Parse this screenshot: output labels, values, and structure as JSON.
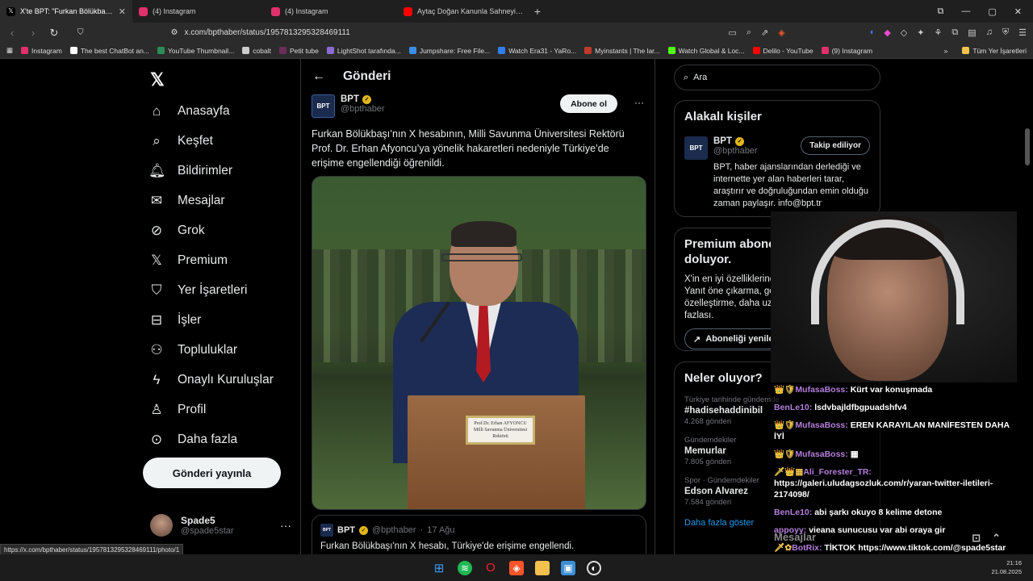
{
  "browser": {
    "tabs": [
      {
        "label": "X'te BPT: \"Furkan Bölükbaşı'nın X",
        "color": "#000000",
        "icon": "x-logo-icon"
      },
      {
        "label": "(4) Instagram",
        "color": "#e1306c",
        "icon": "instagram-icon"
      },
      {
        "label": "(4) Instagram",
        "color": "#e1306c",
        "icon": "instagram-icon"
      },
      {
        "label": "Aytaç Doğan Kanunla Sahneyi Yıktı |",
        "color": "#ff0000",
        "icon": "youtube-icon"
      }
    ],
    "url": "x.com/bpthaber/status/1957813295328469111",
    "bookmarks": [
      {
        "label": "Instagram",
        "color": "#e1306c"
      },
      {
        "label": "The best ChatBot an...",
        "color": "#ffffff"
      },
      {
        "label": "YouTube Thumbnail...",
        "color": "#2e8b57"
      },
      {
        "label": "cobalt",
        "color": "#cccccc"
      },
      {
        "label": "Petit tube",
        "color": "#6b2d5c"
      },
      {
        "label": "LightShot tarafında...",
        "color": "#8a6bd1"
      },
      {
        "label": "Jumpshare: Free File...",
        "color": "#3a8ee6"
      },
      {
        "label": "Watch Era31 - YaRo...",
        "color": "#2f80ed"
      },
      {
        "label": "Myinstants | The lar...",
        "color": "#c0392b"
      },
      {
        "label": "Watch Global & Loc...",
        "color": "#53fc18"
      },
      {
        "label": "Delilo - YouTube",
        "color": "#ff0000"
      },
      {
        "label": "(9) Instagram",
        "color": "#e1306c"
      }
    ],
    "bookmarks_folder": "Tüm Yer İşaretleri",
    "status_link": "https://x.com/bpthaber/status/1957813295328469111/photo/1"
  },
  "nav": {
    "items": [
      {
        "label": "Anasayfa",
        "icon": "home-icon",
        "glyph": "⌂"
      },
      {
        "label": "Keşfet",
        "icon": "search-icon",
        "glyph": "⌕"
      },
      {
        "label": "Bildirimler",
        "icon": "bell-icon",
        "glyph": "🔔︎"
      },
      {
        "label": "Mesajlar",
        "icon": "mail-icon",
        "glyph": "✉"
      },
      {
        "label": "Grok",
        "icon": "grok-icon",
        "glyph": "⊘"
      },
      {
        "label": "Premium",
        "icon": "x-premium-icon",
        "glyph": "𝕏"
      },
      {
        "label": "Yer İşaretleri",
        "icon": "bookmark-icon",
        "glyph": "⛉"
      },
      {
        "label": "İşler",
        "icon": "briefcase-icon",
        "glyph": "⊟"
      },
      {
        "label": "Topluluklar",
        "icon": "communities-icon",
        "glyph": "⚇"
      },
      {
        "label": "Onaylı Kuruluşlar",
        "icon": "lightning-icon",
        "glyph": "ϟ"
      },
      {
        "label": "Profil",
        "icon": "profile-icon",
        "glyph": "♙"
      },
      {
        "label": "Daha fazla",
        "icon": "more-circle-icon",
        "glyph": "⊙"
      }
    ],
    "post_button": "Gönderi yayınla",
    "account": {
      "name": "Spade5",
      "handle": "@spade5star"
    }
  },
  "main": {
    "header": "Gönderi",
    "author": {
      "name": "BPT",
      "handle": "@bpthaber",
      "avatar_text": "BPT"
    },
    "subscribe": "Abone ol",
    "text": "Furkan Bölükbaşı’nın X hesabının, Milli Savunma Üniversitesi Rektörü Prof. Dr. Erhan Afyoncu’ya yönelik hakaretleri nedeniyle Türkiye’de erişime engellendiği öğrenildi.",
    "plaque": {
      "line1": "Prof.Dr. Erhan AFYONCU",
      "line2": "Milli Savunma Üniversitesi",
      "line3": "Rektörü"
    },
    "quote": {
      "name": "BPT",
      "handle": "@bpthaber",
      "date": "17 Ağu",
      "text": "Furkan Bölükbaşı'nın X hesabı, Türkiye'de erişime engellendi."
    }
  },
  "right": {
    "search_placeholder": "Ara",
    "related": {
      "title": "Alakalı kişiler",
      "name": "BPT",
      "handle": "@bpthaber",
      "follow_label": "Takip ediliyor",
      "bio": "BPT, haber ajanslarından derlediği ve internette yer alan haberleri tarar, araştırır ve doğruluğundan emin olduğu zaman paylaşır. info@bpt.tr"
    },
    "premium": {
      "title": "Premium aboneliğinin süresi doluyor.",
      "text": "X'in en iyi özelliklerinden yararlanmaya d et. Yanıt öne çıkarma, gönderi düze özelleştirme, daha uzun gönderi daha fazlası.",
      "button": "Aboneliği yenile"
    },
    "trends": {
      "title": "Neler oluyor?",
      "items": [
        {
          "meta": "Türkiye tarihinde gündemde",
          "name": "#hadisehaddinibil",
          "count": "4.268 gönderi"
        },
        {
          "meta": "Gündemdekiler",
          "name": "Memurlar",
          "count": "7.805 gönderi"
        },
        {
          "meta": "Spor · Gündemdekiler",
          "name": "Edson Alvarez",
          "count": "7.584 gönderi"
        }
      ],
      "show_more": "Daha fazla göster"
    }
  },
  "chat": {
    "messages": [
      {
        "badges": "👑🛡",
        "user": "MufasaBoss:",
        "text": "Kürt var konuşmada"
      },
      {
        "badges": "",
        "user": "BenLe10:",
        "text": "lsdvbajldfbgpuadshfv4"
      },
      {
        "badges": "👑🛡",
        "user": "MufasaBoss:",
        "text": "EREN KARAYILAN MANİFESTEN DAHA İYİ"
      },
      {
        "badges": "👑🛡",
        "user": "MufasaBoss:",
        "text": "▦"
      },
      {
        "badges": "🗡👑▦",
        "user": "Ali_Forester_TR:",
        "text": "https://galeri.uludagsozluk.com/r/yaran-twitter-iletileri-2174098/"
      },
      {
        "badges": "",
        "user": "BenLe10:",
        "text": "abi şarkı okuyo 8 kelime detone"
      },
      {
        "badges": "",
        "user": "appoyy:",
        "text": "vieana sunucusu var abi oraya gir"
      },
      {
        "badges": "🗡✿",
        "user": "BotRix:",
        "text": "TİKTOK https://www.tiktok.com/@spade5star"
      }
    ],
    "input_placeholder": "Mesajlar"
  },
  "taskbar": {
    "time": "21:16",
    "date": "21.08.2025"
  }
}
